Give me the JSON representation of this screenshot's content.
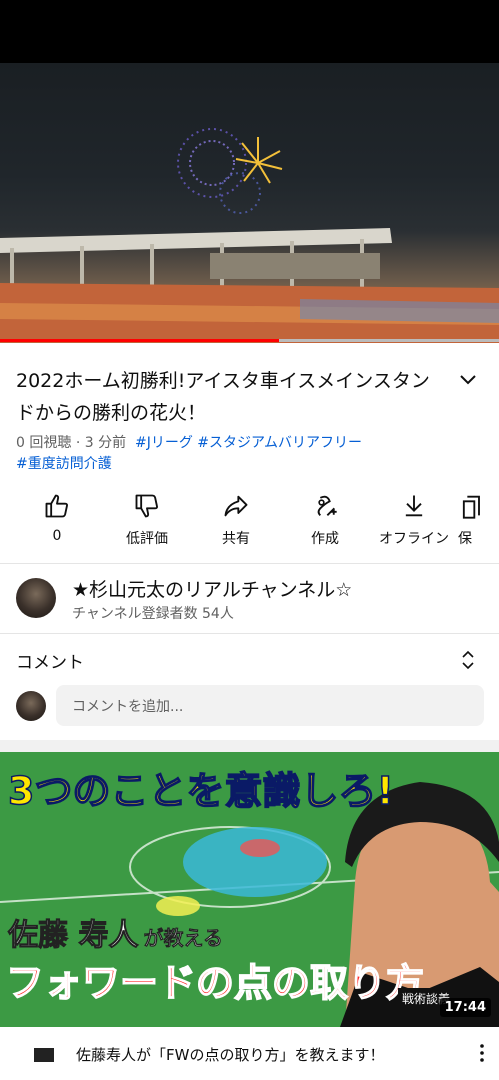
{
  "video": {
    "title": "2022ホーム初勝利!アイスタ車イスメインスタンドからの勝利の花火！",
    "views": "0 回視聴",
    "separator": "·",
    "age": "3 分前",
    "tags": [
      "#Jリーグ",
      "#スタジアムバリアフリー",
      "#重度訪問介護"
    ],
    "progress": 0.56
  },
  "actions": [
    {
      "icon": "thumb-up-icon",
      "label": "0"
    },
    {
      "icon": "thumb-down-icon",
      "label": "低評価"
    },
    {
      "icon": "share-icon",
      "label": "共有"
    },
    {
      "icon": "remix-icon",
      "label": "作成"
    },
    {
      "icon": "download-icon",
      "label": "オフライン"
    },
    {
      "icon": "save-icon",
      "label": "保"
    }
  ],
  "channel": {
    "name": "★杉山元太のリアルチャンネル☆",
    "subscribers": "チャンネル登録者数 54人"
  },
  "comments": {
    "heading": "コメント",
    "placeholder": "コメントを追加..."
  },
  "next_video": {
    "thumb_headline": "3つのことを意識しろ!",
    "thumb_name_a": "佐藤 寿人",
    "thumb_name_b": "が教える",
    "thumb_big": "フォワードの点の取り方",
    "thumb_badge": "戦術談義",
    "duration": "17:44",
    "title": "佐藤寿人が「FWの点の取り方」を教えます！"
  },
  "colors": {
    "accent": "#ff0000",
    "link": "#065fd4",
    "secondary_text": "#606060"
  }
}
